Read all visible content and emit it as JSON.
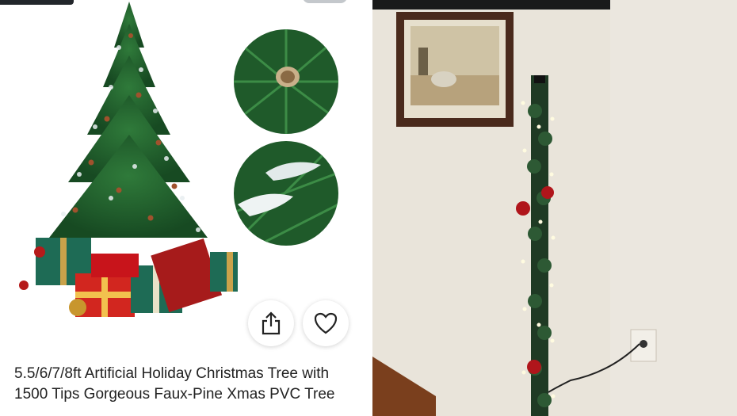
{
  "listing": {
    "title": "5.5/6/7/8ft Artificial Holiday Christmas Tree with 1500 Tips Gorgeous Faux-Pine Xmas PVC Tree"
  },
  "actions": {
    "share_icon": "share-icon",
    "like_icon": "heart-icon"
  },
  "colors": {
    "tree_green": "#1f5a2a",
    "ornament_red": "#b0151b",
    "wall": "#ece7dd",
    "top_bar": "#22262b"
  }
}
